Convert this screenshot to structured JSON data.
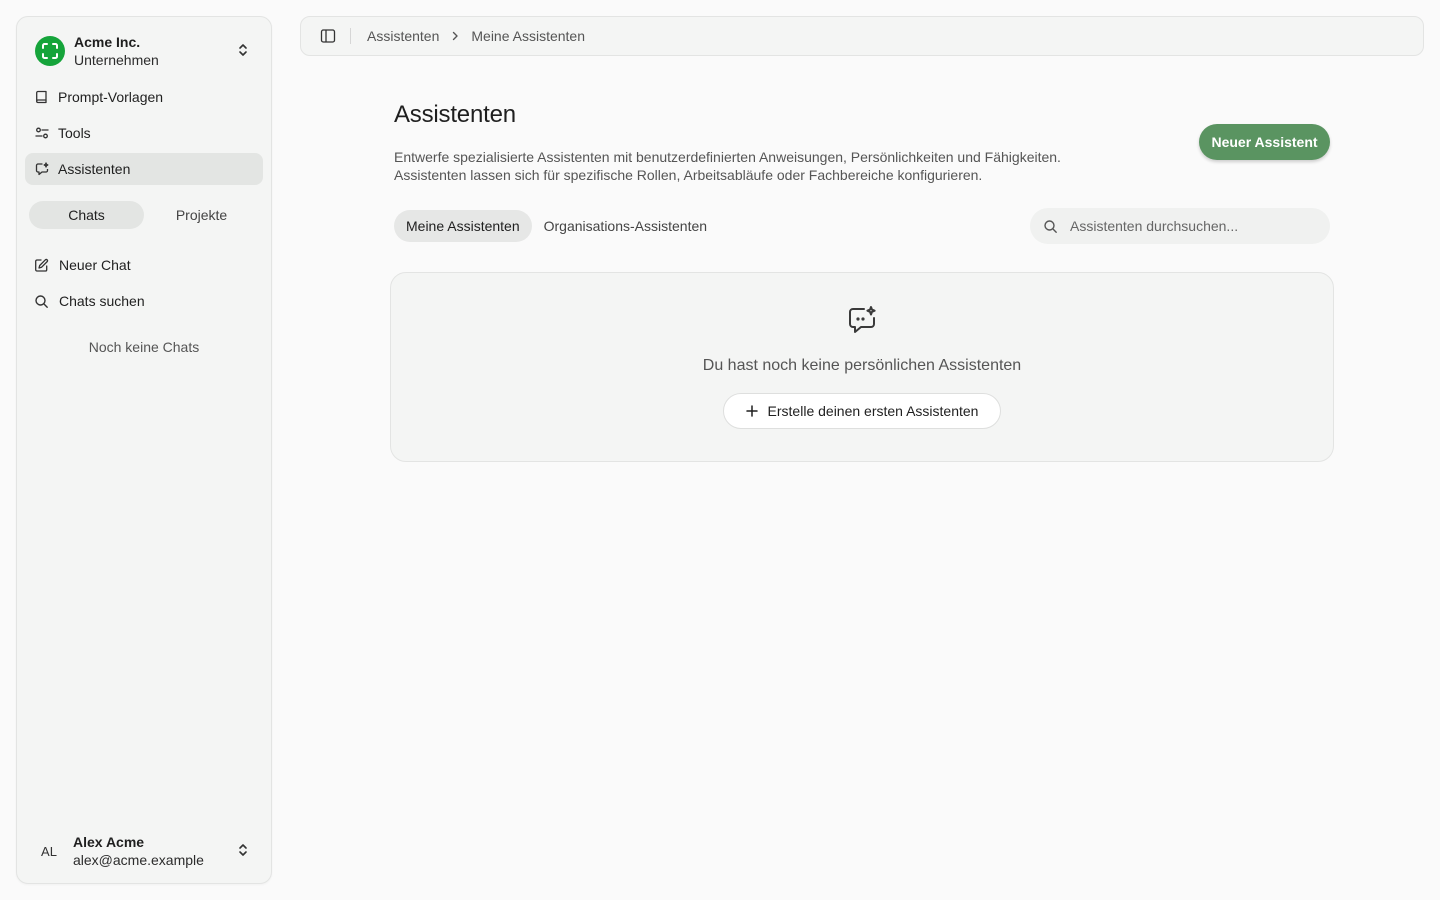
{
  "sidebar": {
    "org": {
      "name": "Acme Inc.",
      "subtitle": "Unternehmen",
      "logo_color": "#15a43a"
    },
    "items": [
      {
        "label": "Prompt-Vorlagen",
        "icon": "book-icon"
      },
      {
        "label": "Tools",
        "icon": "sliders-icon"
      },
      {
        "label": "Assistenten",
        "icon": "chat-sparkle-icon",
        "active": true
      }
    ],
    "segments": [
      {
        "label": "Chats",
        "active": true
      },
      {
        "label": "Projekte"
      }
    ],
    "actions": [
      {
        "label": "Neuer Chat",
        "icon": "edit-icon"
      },
      {
        "label": "Chats suchen",
        "icon": "search-icon"
      }
    ],
    "empty_text": "Noch keine Chats",
    "user": {
      "initials": "AL",
      "name": "Alex Acme",
      "email": "alex@acme.example"
    }
  },
  "breadcrumb": [
    "Assistenten",
    "Meine Assistenten"
  ],
  "main": {
    "title": "Assistenten",
    "description_lines": [
      "Entwerfe spezialisierte Assistenten mit benutzerdefinierten Anweisungen, Persönlichkeiten und Fähigkeiten.",
      "Assistenten lassen sich für spezifische Rollen, Arbeitsabläufe oder Fachbereiche konfigurieren."
    ],
    "new_button": "Neuer Assistent",
    "accent_color": "#5a9461",
    "tabs": [
      {
        "label": "Meine Assistenten",
        "active": true
      },
      {
        "label": "Organisations-Assistenten"
      }
    ],
    "search_placeholder": "Assistenten durchsuchen...",
    "empty_state": {
      "icon": "chat-sparkle-icon",
      "text": "Du hast noch keine persönlichen Assistenten",
      "button": "Erstelle deinen ersten Assistenten"
    }
  }
}
